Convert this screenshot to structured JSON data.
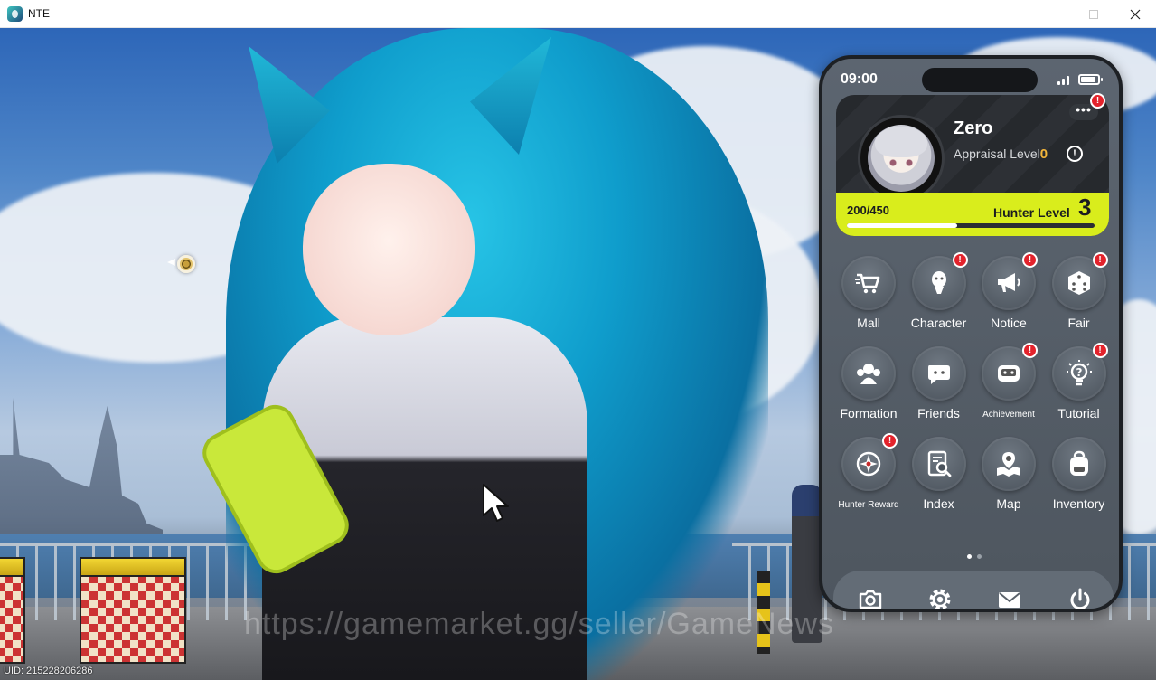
{
  "window": {
    "title": "NTE",
    "minimize_icon": "minimize-icon",
    "maximize_icon": "maximize-icon",
    "close_icon": "close-icon"
  },
  "scene": {
    "watermark": "https://gamemarket.gg/seller/GameNews",
    "uid_text": "UID: 215228206286"
  },
  "phone": {
    "time": "09:00",
    "profile": {
      "name": "Zero",
      "appraisal_label": "Appraisal Level",
      "appraisal_value": "0",
      "xp_text": "200/450",
      "xp_progress": 0.444,
      "hunter_label": "Hunter Level",
      "hunter_value": "3",
      "more_label": "•••",
      "info_label": "!"
    },
    "apps": [
      {
        "label": "Mall",
        "icon": "cart-icon",
        "badge": false
      },
      {
        "label": "Character",
        "icon": "character-icon",
        "badge": true
      },
      {
        "label": "Notice",
        "icon": "megaphone-icon",
        "badge": true
      },
      {
        "label": "Fair",
        "icon": "dice-icon",
        "badge": true
      },
      {
        "label": "Formation",
        "icon": "formation-icon",
        "badge": false
      },
      {
        "label": "Friends",
        "icon": "friends-icon",
        "badge": false
      },
      {
        "label": "Achievement",
        "icon": "achievement-icon",
        "badge": true
      },
      {
        "label": "Tutorial",
        "icon": "lightbulb-icon",
        "badge": true
      },
      {
        "label": "Hunter Reward",
        "icon": "hunter-reward-icon",
        "badge": true
      },
      {
        "label": "Index",
        "icon": "index-icon",
        "badge": false
      },
      {
        "label": "Map",
        "icon": "map-icon",
        "badge": false
      },
      {
        "label": "Inventory",
        "icon": "backpack-icon",
        "badge": false
      }
    ],
    "badge_glyph": "!",
    "pager": {
      "pages": 2,
      "current": 1
    },
    "dock": [
      "camera-icon",
      "settings-icon",
      "mail-icon",
      "power-icon"
    ],
    "colors": {
      "accent": "#d9ed1c",
      "badge": "#e3232c",
      "appraisal": "#f4b63a"
    }
  }
}
